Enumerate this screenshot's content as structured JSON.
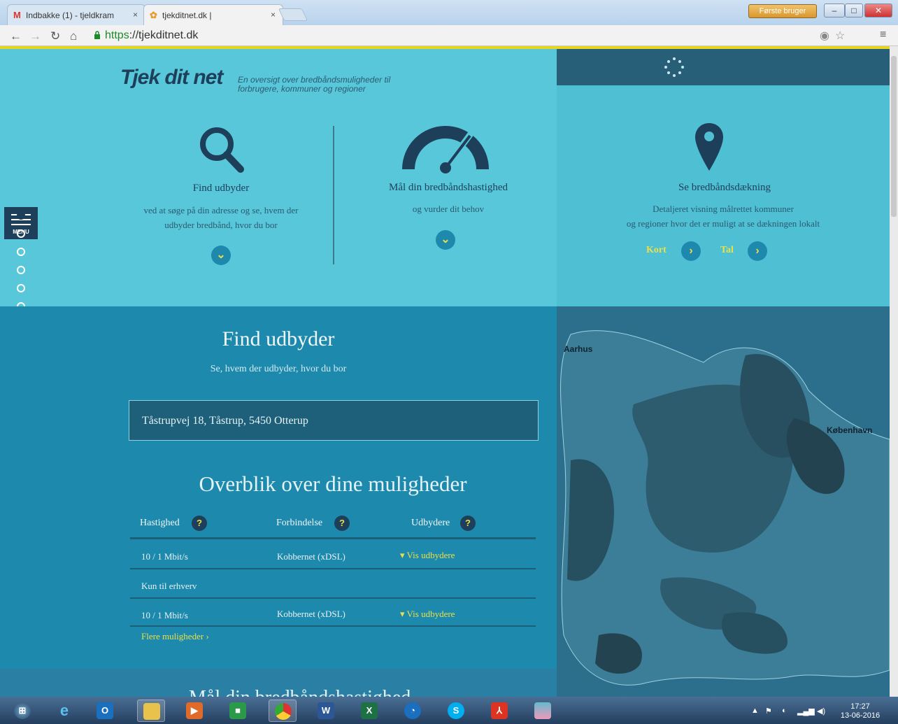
{
  "browser": {
    "tabs": [
      {
        "label": "Indbakke (1) - tjeldkram",
        "favicon": "M"
      },
      {
        "label": "tjekditnet.dk |",
        "favicon": "✿"
      }
    ],
    "user_button": "Første bruger",
    "url_scheme": "https",
    "url_rest": "://tjekditnet.dk"
  },
  "header": {
    "logo": "Tjek dit net",
    "tagline": "En oversigt over bredbåndsmuligheder til forbrugere, kommuner og regioner"
  },
  "columns": [
    {
      "title": "Find udbyder",
      "desc1": "ved at søge på din adresse og se, hvem der",
      "desc2": "udbyder bredbånd, hvor du bor"
    },
    {
      "title": "Mål din bredbåndshastighed",
      "desc1": "og vurder dit behov"
    },
    {
      "title": "Se bredbåndsdækning",
      "desc1": "Detaljeret visning målrettet kommuner",
      "desc2": "og regioner hvor det er muligt at se dækningen lokalt",
      "link_kort": "Kort",
      "link_tal": "Tal"
    }
  ],
  "menu": {
    "label": "MENU"
  },
  "find": {
    "title": "Find udbyder",
    "subtitle": "Se, hvem der udbyder, hvor du bor",
    "address_value": "Tåstrupvej 18, Tåstrup, 5450 Otterup"
  },
  "overview": {
    "title": "Overblik over dine muligheder",
    "headers": [
      "Hastighed",
      "Forbindelse",
      "Udbydere"
    ],
    "rows": [
      {
        "speed": "10 / 1 Mbit/s",
        "connection": "Kobbernet (xDSL)",
        "providers": "Vis udbydere"
      },
      {
        "speed": "Kun til erhverv"
      },
      {
        "speed": "10 / 1 Mbit/s",
        "connection": "Kobbernet (xDSL)",
        "providers": "Vis udbydere"
      }
    ],
    "more": "Flere muligheder",
    "next_section_partial": "Mål din bredbåndshastighed"
  },
  "map": {
    "labels": [
      "Aarhus",
      "København"
    ]
  },
  "taskbar": {
    "time": "17:27",
    "date": "13-06-2016"
  },
  "colors": {
    "hero_bg": "#58c7d9",
    "find_bg": "#1d89ad",
    "accent_yellow": "#e8e04a",
    "dark_navy": "#1d3f5a"
  }
}
